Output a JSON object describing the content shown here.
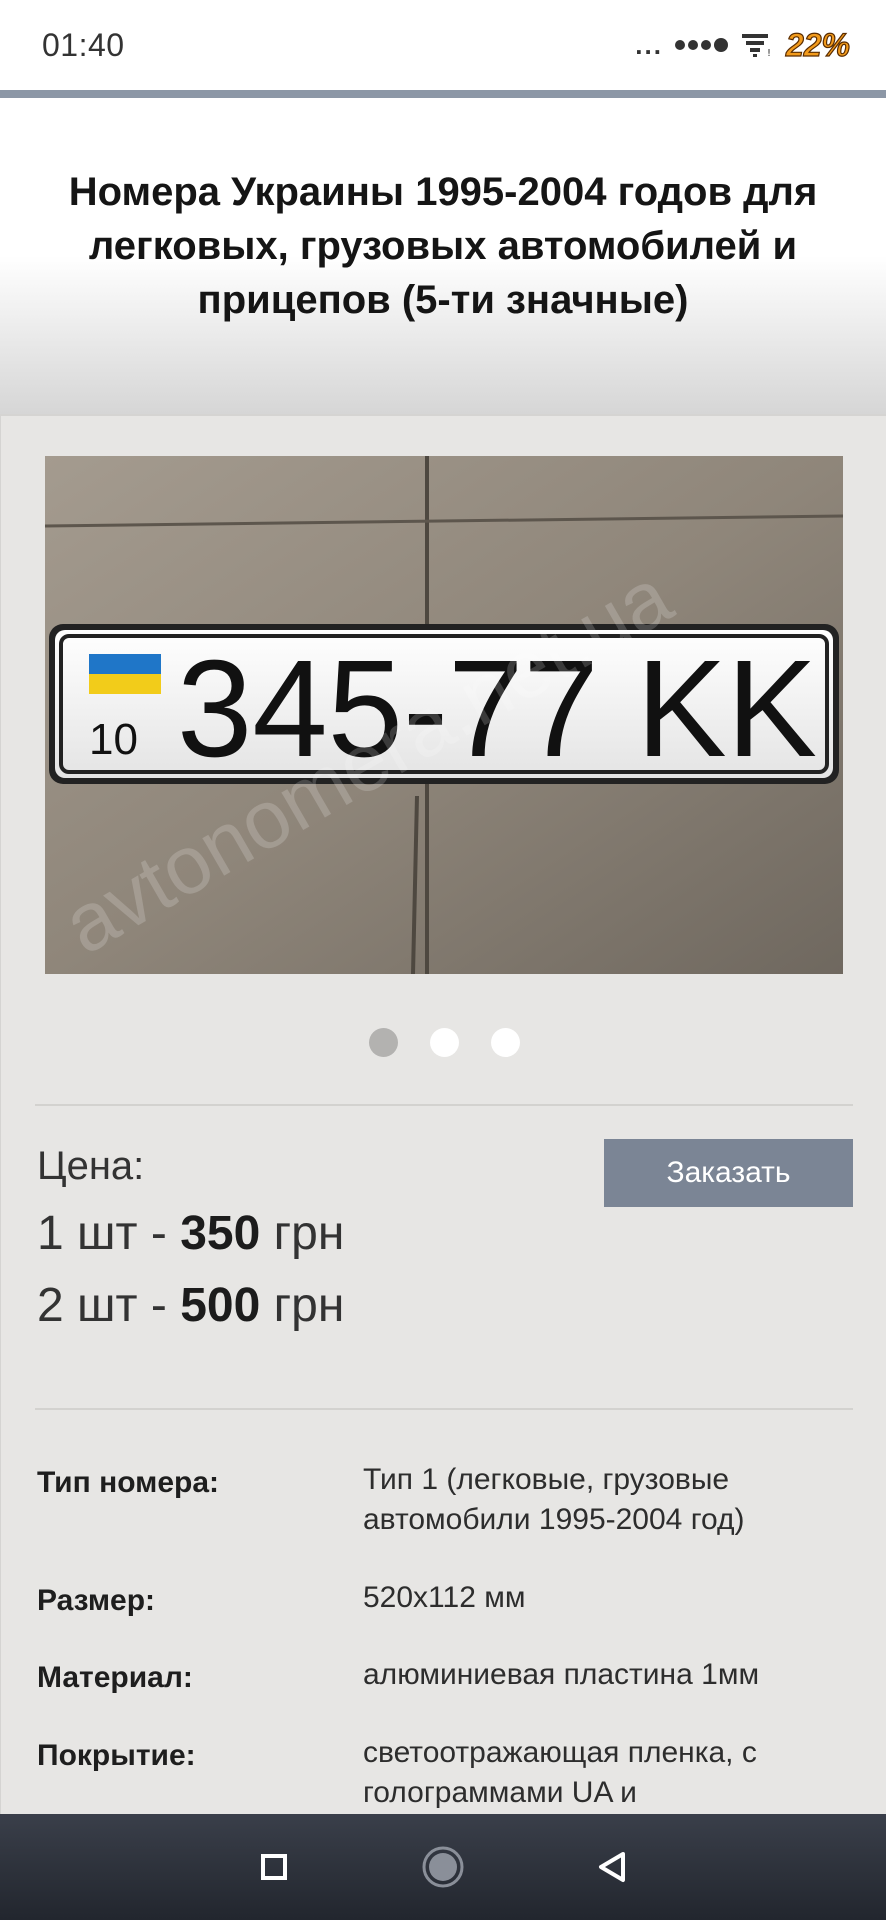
{
  "status_bar": {
    "time": "01:40",
    "overflow_dots": "...",
    "battery": "22%"
  },
  "header": {
    "title": "Номера Украины 1995-2004 годов для легковых, грузовых автомобилей и прицепов (5-ти значные)"
  },
  "product": {
    "image": {
      "plate_text": "345-77 KK",
      "plate_region": "10",
      "watermark": "avtonomera.net.ua",
      "flag_colors": [
        "#1f76c8",
        "#f2cc1a"
      ]
    },
    "carousel": {
      "count": 3,
      "active_index": 0
    },
    "price": {
      "label": "Цена:",
      "rows": [
        {
          "qty": "1 шт - ",
          "amount": "350",
          "currency": " грн"
        },
        {
          "qty": "2 шт - ",
          "amount": "500",
          "currency": " грн"
        }
      ]
    },
    "order_button": "Заказать",
    "specs": [
      {
        "label": "Тип номера:",
        "value": "Тип 1 (легковые, грузовые автомобили 1995-2004 год)"
      },
      {
        "label": "Размер:",
        "value": "520x112 мм"
      },
      {
        "label": "Материал:",
        "value": "алюминиевая пластина 1мм"
      },
      {
        "label": "Покрытие:",
        "value": "светоотражающая пленка, с голограммами UA и"
      }
    ]
  },
  "colors": {
    "order_button_bg": "#7b8595",
    "page_bg": "#e7e6e4",
    "battery": "#f29b1c"
  }
}
